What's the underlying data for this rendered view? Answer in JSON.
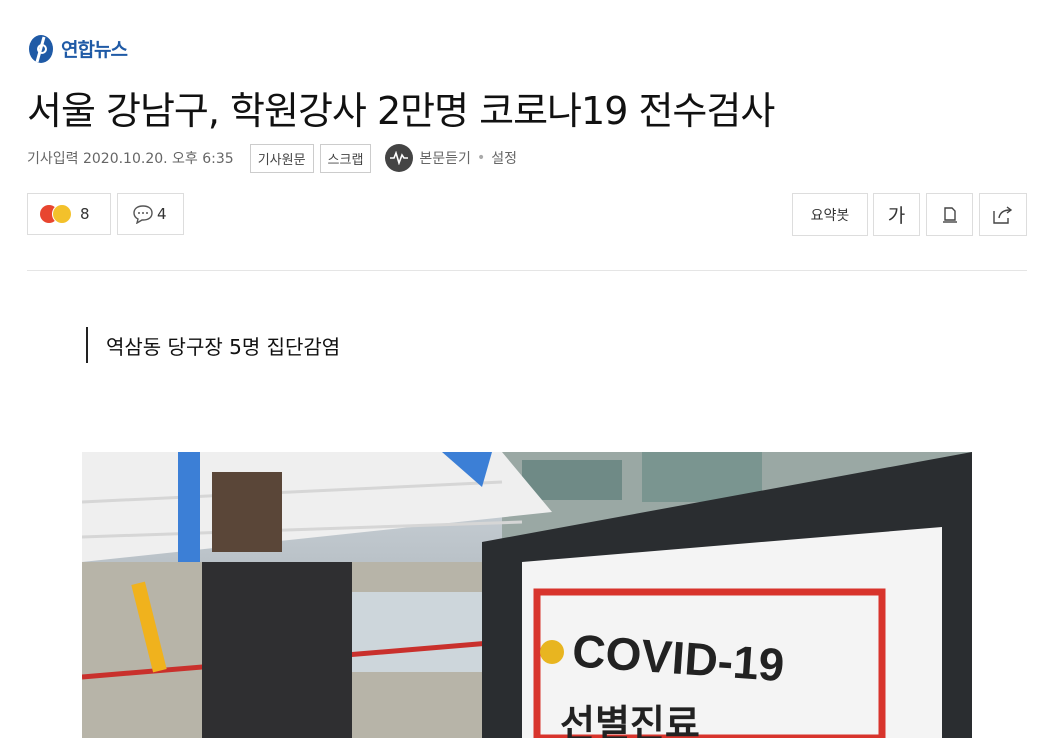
{
  "brand": {
    "name": "연합뉴스",
    "accent": "#1f5aa6"
  },
  "article": {
    "title": "서울 강남구, 학원강사 2만명 코로나19 전수검사",
    "date": "기사입력 2020.10.20. 오후 6:35",
    "subhead": "역삼동 당구장 5명 집단감염"
  },
  "meta_buttons": {
    "original": "기사원문",
    "scrap": "스크랩",
    "listen": "본문듣기",
    "settings": "설정"
  },
  "reactions": {
    "emotion_count": "8",
    "comment_count": "4"
  },
  "tools": {
    "summary": "요약봇",
    "font": "가",
    "print_icon": "print-icon",
    "share_icon": "share-icon"
  },
  "photo": {
    "sign_main": "COVID-19",
    "sign_sub": "선별진료",
    "colors": {
      "sign_red": "#d8342c",
      "tent": "#f2f2f2",
      "blue_flag": "#3c7fd6"
    }
  }
}
